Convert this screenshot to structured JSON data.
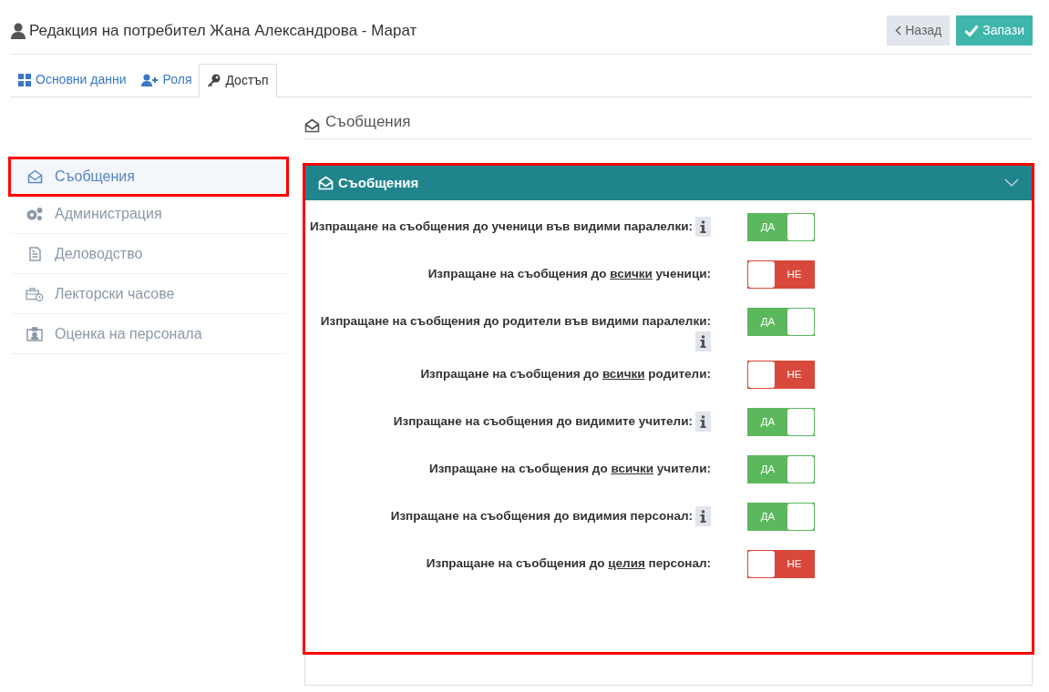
{
  "header": {
    "title": "Редакция на потребител Жана Александрова - Марат",
    "buttons": [
      {
        "kind": "back",
        "label": "Назад"
      },
      {
        "kind": "save",
        "label": "Запази"
      }
    ]
  },
  "tabs": [
    {
      "kind": "grid",
      "label": "Основни данни",
      "selected": false
    },
    {
      "kind": "user-plus",
      "label": "Роля",
      "selected": false
    },
    {
      "kind": "key",
      "label": "Достъп",
      "selected": true
    }
  ],
  "sidebar": {
    "items": [
      {
        "kind": "envelope",
        "label": "Съобщения",
        "selected": true,
        "highlighted": true
      },
      {
        "kind": "gears",
        "label": "Администрация",
        "selected": false,
        "highlighted": false
      },
      {
        "kind": "document",
        "label": "Деловодство",
        "selected": false,
        "highlighted": false
      },
      {
        "kind": "briefcase",
        "label": "Лекторски часове",
        "selected": false,
        "highlighted": false
      },
      {
        "kind": "badge",
        "label": "Оценка на персонала",
        "selected": false,
        "highlighted": false
      }
    ]
  },
  "section_title": "Съобщения",
  "panel": {
    "title": "Съобщения",
    "expanded": true,
    "highlighted": true,
    "settings": [
      {
        "parts": [
          {
            "text": "Изпращане на съобщения до ученици във видими паралелки:",
            "underline": false
          }
        ],
        "info": true,
        "on": true,
        "toggle_label": "ДА"
      },
      {
        "parts": [
          {
            "text": "Изпращане на съобщения до ",
            "underline": false
          },
          {
            "text": "всички",
            "underline": true
          },
          {
            "text": " ученици:",
            "underline": false
          }
        ],
        "info": false,
        "on": false,
        "toggle_label": "НЕ"
      },
      {
        "parts": [
          {
            "text": "Изпращане на съобщения до родители във видими паралелки:",
            "underline": false
          }
        ],
        "info": true,
        "on": true,
        "toggle_label": "ДА"
      },
      {
        "parts": [
          {
            "text": "Изпращане на съобщения до ",
            "underline": false
          },
          {
            "text": "всички",
            "underline": true
          },
          {
            "text": " родители:",
            "underline": false
          }
        ],
        "info": false,
        "on": false,
        "toggle_label": "НЕ"
      },
      {
        "parts": [
          {
            "text": "Изпращане на съобщения до видимите учители:",
            "underline": false
          }
        ],
        "info": true,
        "on": true,
        "toggle_label": "ДА"
      },
      {
        "parts": [
          {
            "text": "Изпращане на съобщения до ",
            "underline": false
          },
          {
            "text": "всички",
            "underline": true
          },
          {
            "text": " учители:",
            "underline": false
          }
        ],
        "info": false,
        "on": true,
        "toggle_label": "ДА"
      },
      {
        "parts": [
          {
            "text": "Изпращане на съобщения до видимия персонал:",
            "underline": false
          }
        ],
        "info": true,
        "on": true,
        "toggle_label": "ДА"
      },
      {
        "parts": [
          {
            "text": "Изпращане на съобщения до ",
            "underline": false
          },
          {
            "text": "целия",
            "underline": true
          },
          {
            "text": " персонал:",
            "underline": false
          }
        ],
        "info": false,
        "on": false,
        "toggle_label": "НЕ"
      }
    ]
  }
}
